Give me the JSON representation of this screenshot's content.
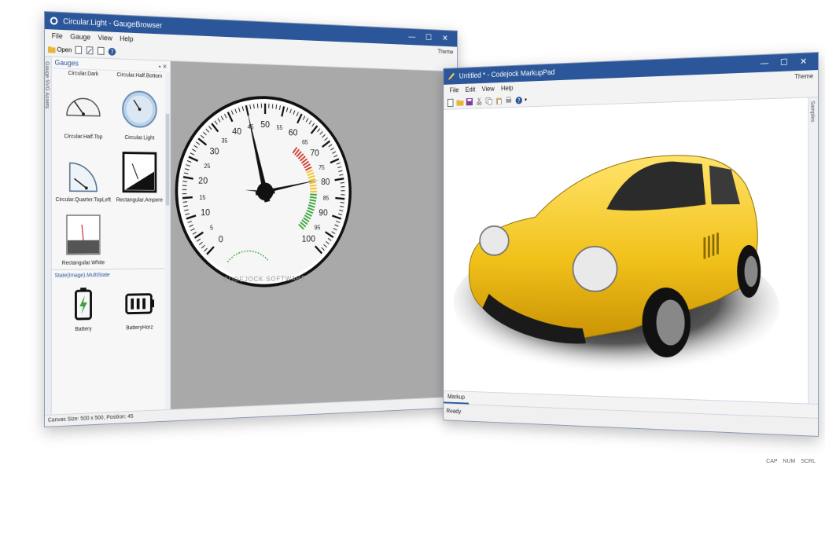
{
  "gauge_window": {
    "title": "Circular.Light - GaugeBrowser",
    "menu": [
      "File",
      "Gauge",
      "View",
      "Help"
    ],
    "theme_label": "Theme",
    "toolbar": {
      "open_label": "Open"
    },
    "side_tab": "Gauge SVG Assets",
    "panel_title": "Gauges",
    "gauges": [
      {
        "label": "Circular.Dark"
      },
      {
        "label": "Circular.Half.Bottom"
      },
      {
        "label": "Circular.Half.Top"
      },
      {
        "label": "Circular.Light"
      },
      {
        "label": "Circular.Quarter.TopLeft"
      },
      {
        "label": "Rectangular.Ampere"
      },
      {
        "label": "Rectangular.White"
      }
    ],
    "section_title": "State(Image).MultiState",
    "states": [
      {
        "label": "Battery"
      },
      {
        "label": "BatteryHorz"
      }
    ],
    "status": "Canvas Size: 500 x 500, Position: 45",
    "dial": {
      "ticks": [
        "0",
        "5",
        "10",
        "15",
        "20",
        "25",
        "30",
        "35",
        "40",
        "45",
        "50",
        "55",
        "60",
        "65",
        "70",
        "75",
        "80",
        "85",
        "90",
        "95",
        "100"
      ],
      "brand": "CODEJOCK SOFTWARE",
      "value": 45
    }
  },
  "markup_window": {
    "title": "Untitled * - Codejock MarkupPad",
    "menu": [
      "File",
      "Edit",
      "View",
      "Help"
    ],
    "theme_label": "Theme",
    "side_tab": "Samples",
    "tab": "Markup",
    "status": "Ready",
    "indicators": [
      "CAP",
      "NUM",
      "SCRL"
    ]
  },
  "colors": {
    "title_blue": "#2b579a",
    "car_yellow": "#f2c21b"
  }
}
